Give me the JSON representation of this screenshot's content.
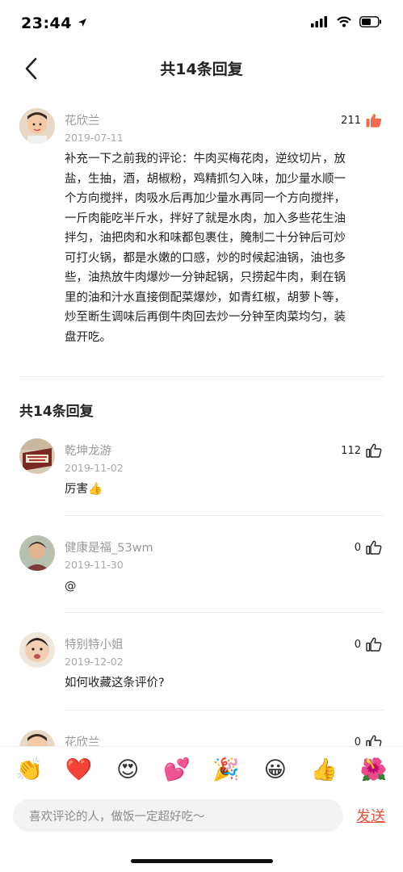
{
  "status_bar": {
    "time": "23:44"
  },
  "nav": {
    "title": "共14条回复"
  },
  "main_comment": {
    "username": "花欣兰",
    "date": "2019-07-11",
    "likes": "211",
    "text": "补充一下之前我的评论：牛肉买梅花肉，逆纹切片，放盐，生抽，酒，胡椒粉，鸡精抓匀入味，加少量水顺一个方向搅拌，肉吸水后再加少量水再同一个方向搅拌，一斤肉能吃半斤水，拌好了就是水肉，加入多些花生油拌匀，油把肉和水和味都包裹住，腌制二十分钟后可炒可打火锅，都是水嫩的口感，炒的时候起油锅，油也多些，油热放牛肉爆炒一分钟起锅，只捞起牛肉，剩在锅里的油和汁水直接倒配菜爆炒，如青红椒，胡萝卜等，炒至断生调味后再倒牛肉回去炒一分钟至肉菜均匀，装盘开吃。"
  },
  "replies_title": "共14条回复",
  "replies": [
    {
      "username": "乾坤龙游",
      "date": "2019-11-02",
      "likes": "112",
      "text": "厉害👍"
    },
    {
      "username": "健康是福_53wm",
      "date": "2019-11-30",
      "likes": "0",
      "text": "@"
    },
    {
      "username": "特别特小姐",
      "date": "2019-12-02",
      "likes": "0",
      "text": "如何收藏这条评价?"
    },
    {
      "username": "花欣兰",
      "likes": "0"
    }
  ],
  "emoji_bar": [
    "👏",
    "❤️",
    "😍",
    "💕",
    "🎉",
    "😀",
    "👍",
    "🌺"
  ],
  "input": {
    "placeholder": "喜欢评论的人，做饭一定超好吃～"
  },
  "send_label": "发送",
  "colors": {
    "accent": "#e8553b",
    "muted": "#9a9a9a"
  }
}
